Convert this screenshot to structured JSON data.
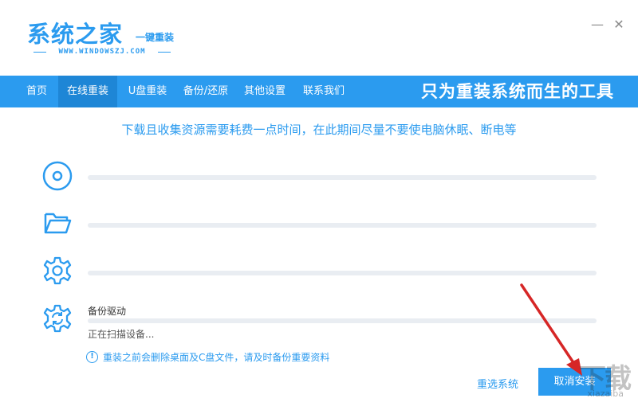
{
  "app": {
    "logo_main": "系统之家",
    "logo_sub": "一键重装",
    "logo_url": "WWW.WINDOWSZJ.COM",
    "minimize_glyph": "—",
    "close_glyph": "✕"
  },
  "nav": {
    "items": [
      {
        "label": "首页"
      },
      {
        "label": "在线重装"
      },
      {
        "label": "U盘重装"
      },
      {
        "label": "备份/还原"
      },
      {
        "label": "其他设置"
      },
      {
        "label": "联系我们"
      }
    ],
    "active_index": 1,
    "slogan": "只为重装系统而生的工具"
  },
  "notice": "下载且收集资源需要耗费一点时间，在此期间尽量不要使电脑休眠、断电等",
  "steps": [
    {
      "icon": "disc-icon",
      "progress": 0
    },
    {
      "icon": "folder-icon",
      "progress": 0
    },
    {
      "icon": "gear-icon",
      "progress": 0
    },
    {
      "icon": "sync-gear-icon",
      "progress": 0,
      "label": "备份驱动",
      "status": "正在扫描设备..."
    }
  ],
  "warning": {
    "icon": "!",
    "text": "重装之前会删除桌面及C盘文件，请及时备份重要资料"
  },
  "actions": {
    "reselect": "重选系统",
    "cancel": "取消安装"
  },
  "watermark": {
    "big": "下载",
    "small": "xiazaiba"
  },
  "colors": {
    "accent": "#2b9bef",
    "nav_active": "#1e86d6",
    "arrow": "#d62626"
  }
}
